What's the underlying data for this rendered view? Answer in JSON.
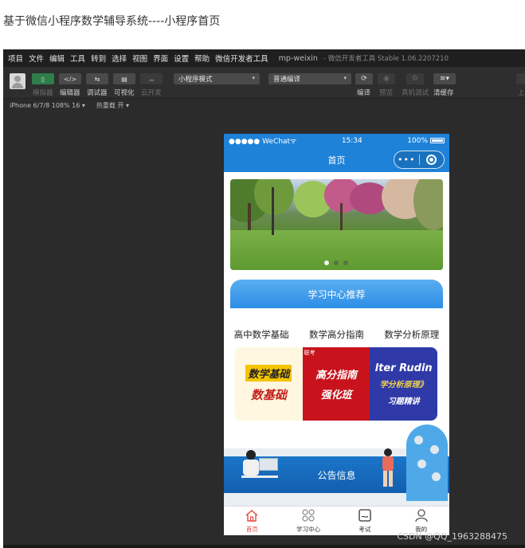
{
  "page_title": "基于微信小程序数学辅导系统----小程序首页",
  "ide": {
    "menu": [
      "项目",
      "文件",
      "编辑",
      "工具",
      "转到",
      "选择",
      "视图",
      "界面",
      "设置",
      "帮助",
      "微信开发者工具"
    ],
    "app_name": "mp-weixin",
    "app_version": "- 微信开发者工具 Stable 1.06.2207210",
    "toolbar": {
      "simulator": "模拟器",
      "editor": "编辑器",
      "debugger": "调试器",
      "visual": "可视化",
      "cloud": "云开发",
      "mode_select": "小程序模式",
      "compile_select": "普通编译",
      "compile": "编译",
      "preview": "预览",
      "remote_debug": "真机调试",
      "clear_cache": "清缓存",
      "upload_partial": "上"
    },
    "subbar": {
      "device": "iPhone 6/7/8 108% 16 ▾",
      "hot_reload": "热重载 开 ▾"
    }
  },
  "phone": {
    "status": {
      "carrier": "●●●●● WeChat",
      "time": "15:34",
      "battery": "100%"
    },
    "nav_title": "首页",
    "section_title": "学习中心推荐",
    "courses": [
      {
        "title": "高中数学基础",
        "line1": "数学基础",
        "line2": "数基础"
      },
      {
        "title": "数学高分指南",
        "line1": "高分指南",
        "line2": "强化班",
        "tag": "联考"
      },
      {
        "title": "数学分析原理",
        "line1": "lter Rudin",
        "line2": "学分析原理》",
        "line3": "习题精讲"
      }
    ],
    "notice_title": "公告信息",
    "tabs": [
      {
        "label": "首页",
        "icon": "home-icon"
      },
      {
        "label": "学习中心",
        "icon": "grid-icon"
      },
      {
        "label": "考试",
        "icon": "exam-icon"
      },
      {
        "label": "我的",
        "icon": "user-icon"
      }
    ]
  },
  "watermark": "CSDN @QQ_1963288475"
}
